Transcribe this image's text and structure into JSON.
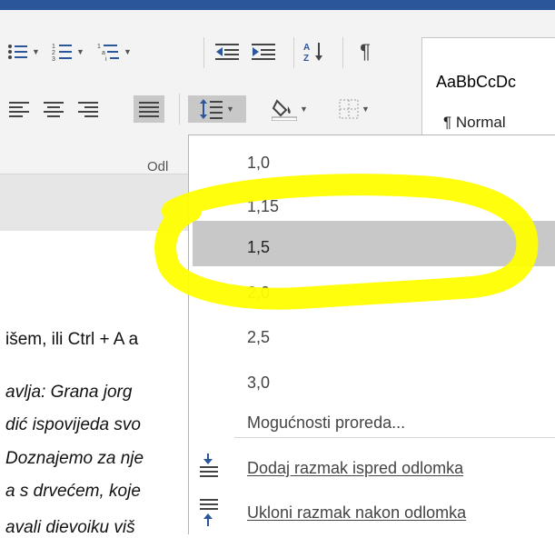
{
  "ribbon": {
    "styles": {
      "sample": "AaBbCcDc",
      "normal": "¶ Normal"
    },
    "group_label": "Odl"
  },
  "document": {
    "lines": [
      "išem, ili Ctrl + A a",
      "avlja: Grana jorg",
      "dić ispovijeda svo",
      "Doznajemo za nje",
      "a s drvećem, koje",
      "avali dievoiku viš"
    ]
  },
  "spacing_menu": {
    "options": [
      "1,0",
      "1,15",
      "1,5",
      "2,0",
      "2,5",
      "3,0"
    ],
    "selected": "1,5",
    "more_options": "Mogućnosti proreda...",
    "add_space_before": "Dodaj razmak ispred odlomka",
    "remove_space_after": "Ukloni razmak nakon odlomka"
  },
  "colors": {
    "ribbon_accent": "#2b579a",
    "annotation": "#ffff00",
    "selection": "#c8c8c8"
  }
}
